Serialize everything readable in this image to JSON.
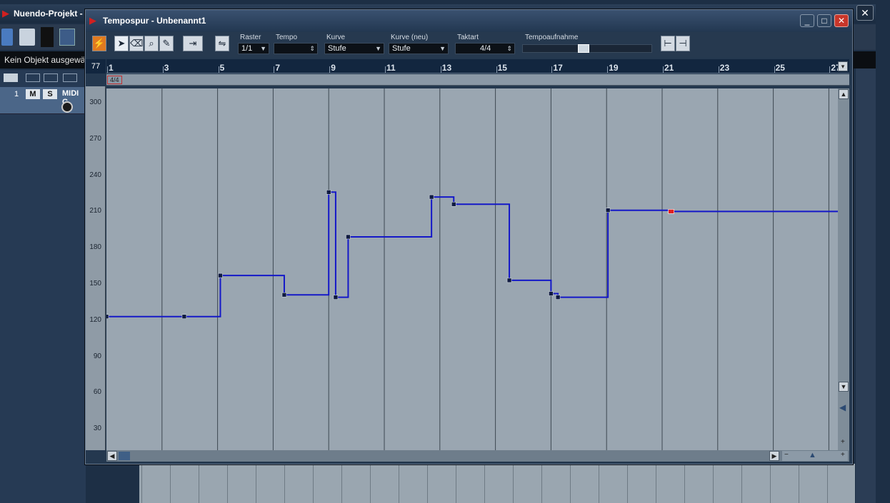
{
  "project": {
    "title": "Nuendo-Projekt - U",
    "status": "Kein Objekt ausgewählt",
    "track_number": "1",
    "track_mute": "M",
    "track_solo": "S",
    "track_name": "MIDI C"
  },
  "dialog": {
    "title": "Tempospur - Unbenannt1",
    "minimize": "_",
    "maximize": "□",
    "close": "✕"
  },
  "toolbar": {
    "raster_label": "Raster",
    "raster_value": "1/1",
    "tempo_label": "Tempo",
    "tempo_value": "",
    "kurve_label": "Kurve",
    "kurve_value": "Stufe",
    "kurve_neu_label": "Kurve (neu)",
    "kurve_neu_value": "Stufe",
    "taktart_label": "Taktart",
    "taktart_value": "4/4",
    "tempoaufnahme_label": "Tempoaufnahme",
    "tempoaufnahme_level": 0.47
  },
  "ruler": {
    "zoom_value": "77",
    "bars": [
      "1",
      "3",
      "5",
      "7",
      "9",
      "11",
      "13",
      "15",
      "17",
      "19",
      "21",
      "23",
      "25",
      "27"
    ]
  },
  "signature_marker": "4/4",
  "tempo_axis": [
    "300",
    "270",
    "240",
    "210",
    "180",
    "150",
    "120",
    "90",
    "60",
    "30"
  ],
  "tempo_points": [
    {
      "bar": 1.0,
      "tempo": 123
    },
    {
      "bar": 3.8,
      "tempo": 123
    },
    {
      "bar": 5.1,
      "tempo": 157
    },
    {
      "bar": 7.4,
      "tempo": 141
    },
    {
      "bar": 9.0,
      "tempo": 226
    },
    {
      "bar": 9.25,
      "tempo": 139
    },
    {
      "bar": 9.7,
      "tempo": 189
    },
    {
      "bar": 12.7,
      "tempo": 222
    },
    {
      "bar": 13.5,
      "tempo": 216
    },
    {
      "bar": 15.5,
      "tempo": 153
    },
    {
      "bar": 17.0,
      "tempo": 142
    },
    {
      "bar": 17.25,
      "tempo": 139
    },
    {
      "bar": 19.05,
      "tempo": 211
    },
    {
      "bar": 21.3,
      "tempo": 210
    }
  ],
  "colors": {
    "curve": "#1418c8",
    "point": "#0f1a40",
    "selected_point": "#e02020",
    "plot_bg": "#9aa6b1",
    "grid": "#3e4852"
  }
}
